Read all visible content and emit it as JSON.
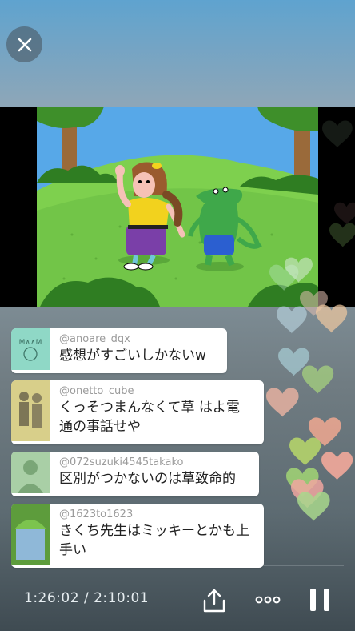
{
  "icons": {
    "close": "close-icon",
    "share": "share-icon",
    "more": "more-dots-icon",
    "pause": "pause-icon"
  },
  "colors": {
    "comment_bg": "#ffffff",
    "username": "#9b9b9b",
    "comment_text": "#222222",
    "controls": "#ffffff"
  },
  "comments": [
    {
      "user": "@anoare_dqx",
      "text": "感想がすごいしかないw"
    },
    {
      "user": "@onetto_cube",
      "text": "くっそつまんなくて草 はよ電通の事話せや"
    },
    {
      "user": "@072suzuki4545takako",
      "text": "区別がつかないのは草致命的"
    },
    {
      "user": "@1623to1623",
      "text": "きくち先生はミッキーとかも上手い"
    }
  ],
  "player": {
    "time": "1:26:02 / 2:10:01"
  }
}
